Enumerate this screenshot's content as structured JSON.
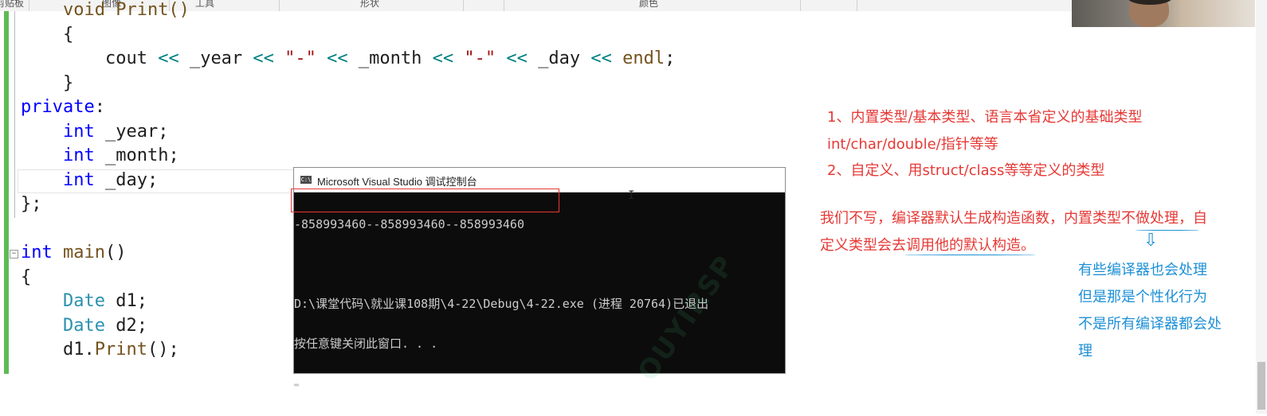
{
  "ribbon": {
    "items": [
      "剪贴板",
      "图像",
      "工具",
      "形状",
      "颜色"
    ]
  },
  "editor": {
    "lines": [
      {
        "indent": "    ",
        "parts": [
          [
            "fn",
            "void Print()"
          ]
        ]
      },
      {
        "indent": "    ",
        "parts": [
          [
            "",
            "{"
          ]
        ]
      },
      {
        "indent": "        ",
        "parts": [
          [
            "",
            "cout "
          ],
          [
            "op",
            "<<"
          ],
          [
            "",
            " _year "
          ],
          [
            "op",
            "<<"
          ],
          [
            "",
            " "
          ],
          [
            "str",
            "\"-\""
          ],
          [
            "",
            " "
          ],
          [
            "op",
            "<<"
          ],
          [
            "",
            " _month "
          ],
          [
            "op",
            "<<"
          ],
          [
            "",
            " "
          ],
          [
            "str",
            "\"-\""
          ],
          [
            "",
            " "
          ],
          [
            "op",
            "<<"
          ],
          [
            "",
            " _day "
          ],
          [
            "op",
            "<<"
          ],
          [
            "",
            " "
          ],
          [
            "fn",
            "endl"
          ],
          [
            "",
            ";"
          ]
        ]
      },
      {
        "indent": "    ",
        "parts": [
          [
            "",
            "}"
          ]
        ]
      },
      {
        "indent": "",
        "parts": [
          [
            "kw",
            "private"
          ],
          [
            "",
            ":"
          ]
        ]
      },
      {
        "indent": "    ",
        "parts": [
          [
            "kw",
            "int"
          ],
          [
            "",
            " _year;"
          ]
        ]
      },
      {
        "indent": "    ",
        "parts": [
          [
            "kw",
            "int"
          ],
          [
            "",
            " _month;"
          ]
        ]
      },
      {
        "indent": "    ",
        "parts": [
          [
            "kw",
            "int"
          ],
          [
            "",
            " _day;"
          ]
        ]
      },
      {
        "indent": "",
        "parts": [
          [
            "",
            "};"
          ]
        ]
      },
      {
        "indent": "",
        "parts": [
          [
            "",
            ""
          ]
        ]
      },
      {
        "indent": "",
        "parts": [
          [
            "kw",
            "int"
          ],
          [
            "",
            " "
          ],
          [
            "fn",
            "main"
          ],
          [
            "",
            "()"
          ]
        ]
      },
      {
        "indent": "",
        "parts": [
          [
            "",
            "{"
          ]
        ]
      },
      {
        "indent": "    ",
        "parts": [
          [
            "ty",
            "Date"
          ],
          [
            "",
            " d1;"
          ]
        ]
      },
      {
        "indent": "    ",
        "parts": [
          [
            "ty",
            "Date"
          ],
          [
            "",
            " d2;"
          ]
        ]
      },
      {
        "indent": "    ",
        "parts": [
          [
            "",
            "d1."
          ],
          [
            "fn",
            "Print"
          ],
          [
            "",
            "();"
          ]
        ]
      }
    ],
    "fold_marker": "−"
  },
  "console": {
    "icon_text": "C:\\",
    "title": "Microsoft Visual Studio 调试控制台",
    "lines": [
      "-858993460--858993460--858993460",
      "",
      "D:\\课堂代码\\就业课108期\\4-22\\Debug\\4-22.exe (进程 20764)已退出",
      "按任意键关闭此窗口. . .",
      "▂"
    ],
    "cursor_glyph": "I"
  },
  "watermark": "OUYIRSP",
  "annotations": {
    "point1": "1、内置类型/基本类型、语言本省定义的基础类型",
    "point1b": "int/char/double/指针等等",
    "point2": "2、自定义、用struct/class等等定义的类型",
    "summary1": "我们不写，编译器默认生成构造函数，内置类型不做处理，自",
    "summary2": "定义类型会去调用他的默认构造。",
    "arrow": "⇩",
    "blue1": "有些编译器也会处理",
    "blue2": "但是那是个性化行为",
    "blue3": "不是所有编译器都会处",
    "blue4": "理"
  },
  "colors": {
    "annotation_red": "#e53935",
    "annotation_blue": "#1e90d6",
    "change_bar": "#5dbb55",
    "console_bg": "#0c0c0c"
  }
}
